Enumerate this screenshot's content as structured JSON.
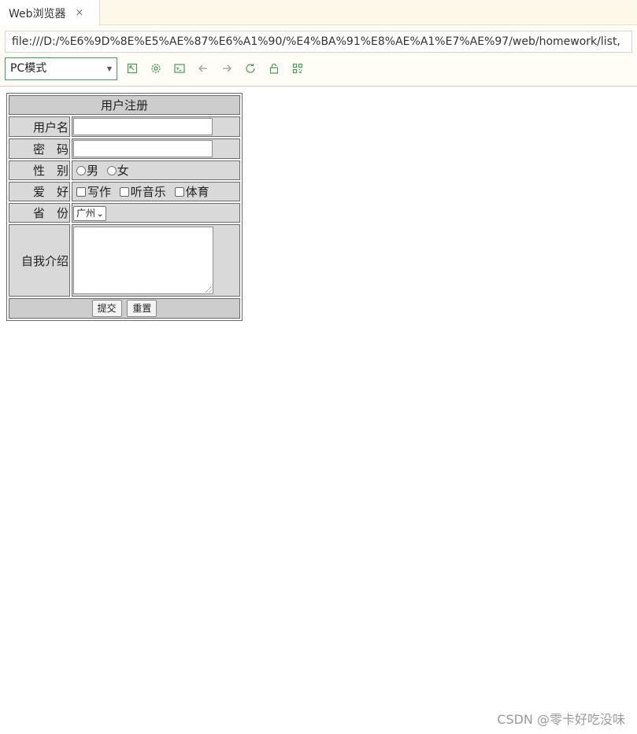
{
  "tab": {
    "title": "Web浏览器",
    "close_glyph": "×"
  },
  "address": {
    "url": "file:///D:/%E6%9D%8E%E5%AE%87%E6%A1%90/%E4%BA%91%E8%AE%A1%E7%AE%97/web/homework/list,"
  },
  "mode_select": {
    "value": "PC模式"
  },
  "toolbar_icons": [
    "window-icon",
    "settings-icon",
    "console-icon",
    "back-arrow-icon",
    "forward-arrow-icon",
    "refresh-icon",
    "lock-icon",
    "qr-code-icon"
  ],
  "accent_color": "#3aa25a",
  "form": {
    "title": "用户注册",
    "username_label": "用户名",
    "password_label": "密　码",
    "gender_label": "性　别",
    "gender_options": [
      "男",
      "女"
    ],
    "hobby_label": "爱　好",
    "hobby_options": [
      "写作",
      "听音乐",
      "体育"
    ],
    "province_label": "省　份",
    "province_value": "广州",
    "intro_label": "自我介绍",
    "submit_label": "提交",
    "reset_label": "重置"
  },
  "watermark": "CSDN @零卡好吃没味"
}
